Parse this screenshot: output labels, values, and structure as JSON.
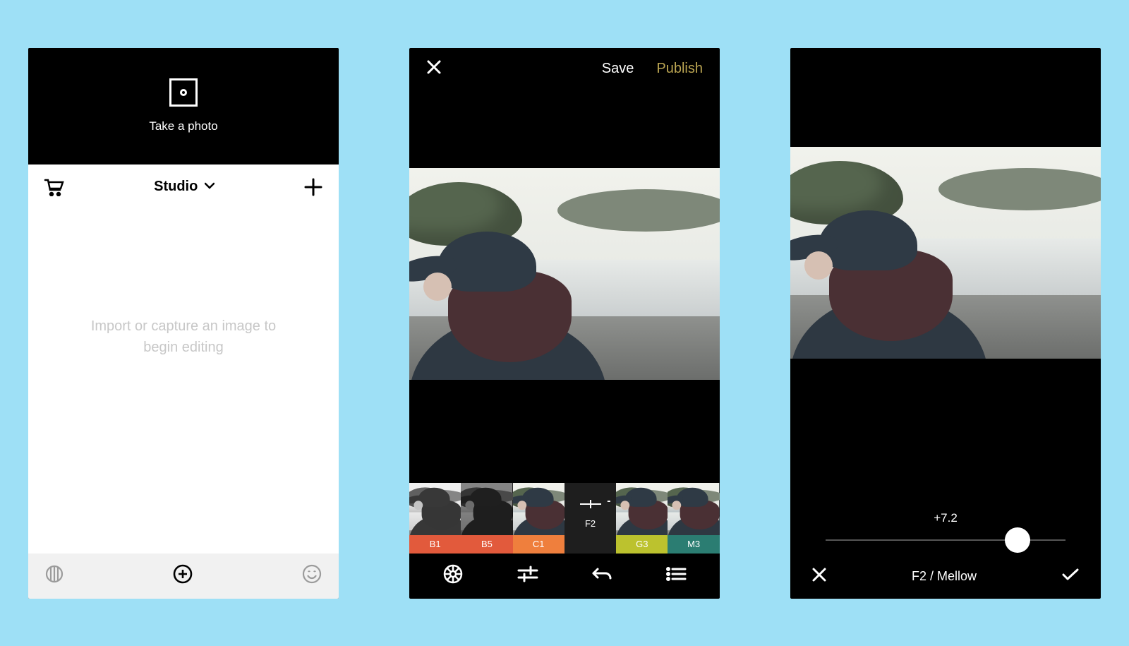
{
  "screen1": {
    "take_photo_label": "Take a photo",
    "studio_title": "Studio",
    "hint_line1": "Import or capture an image to",
    "hint_line2": "begin editing"
  },
  "screen2": {
    "save_label": "Save",
    "publish_label": "Publish",
    "filters": [
      {
        "code": "B1",
        "color": "#e25a3c"
      },
      {
        "code": "B5",
        "color": "#e25a3c"
      },
      {
        "code": "C1",
        "color": "#ef7f3d"
      },
      {
        "code": "F2",
        "selected": true
      },
      {
        "code": "G3",
        "color": "#bcc22e"
      },
      {
        "code": "M3",
        "color": "#2b7d72"
      }
    ]
  },
  "screen3": {
    "slider_value_label": "+7.2",
    "slider_value": 7.2,
    "slider_min": -12,
    "slider_max": 12,
    "filter_label": "F2 / Mellow"
  }
}
